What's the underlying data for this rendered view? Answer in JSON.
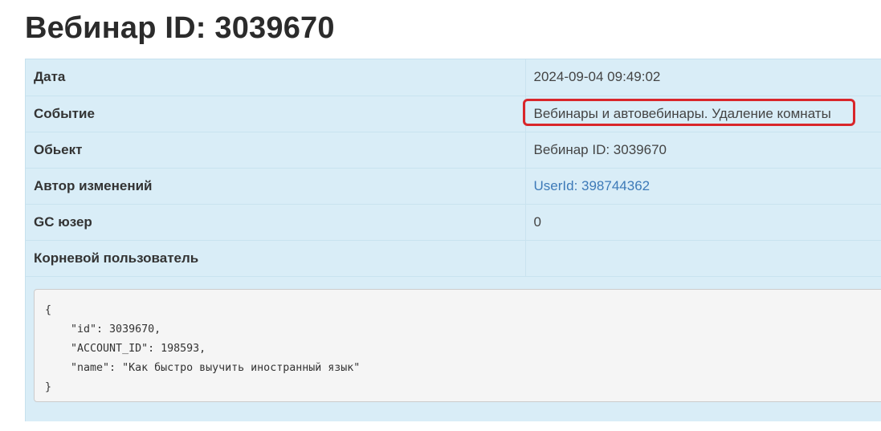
{
  "page": {
    "title": "Вебинар ID: 3039670"
  },
  "details": {
    "rows": [
      {
        "label": "Дата",
        "value": "2024-09-04 09:49:02"
      },
      {
        "label": "Событие",
        "value": "Вебинары и автовебинары. Удаление комнаты",
        "highlighted": true
      },
      {
        "label": "Обьект",
        "value": "Вебинар ID: 3039670"
      },
      {
        "label": "Автор изменений",
        "value": "UserId: 398744362",
        "is_link": true
      },
      {
        "label": "GC юзер",
        "value": "0"
      },
      {
        "label": "Корневой пользователь",
        "value": ""
      }
    ]
  },
  "payload": {
    "json_text": "{\n    \"id\": 3039670,\n    \"ACCOUNT_ID\": 198593,\n    \"name\": \"Как быстро выучить иностранный язык\"\n}"
  },
  "colors": {
    "panel_background": "#d9edf7",
    "highlight_border": "#d9262a",
    "link": "#3d7ab8"
  }
}
